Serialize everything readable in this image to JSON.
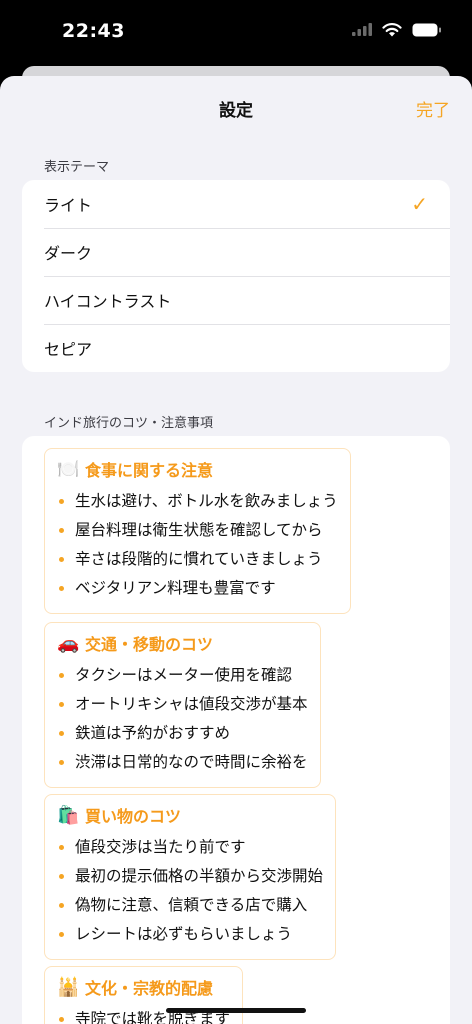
{
  "status": {
    "time": "22:43"
  },
  "nav": {
    "title": "設定",
    "done_label": "完了"
  },
  "theme_section": {
    "header": "表示テーマ",
    "options": [
      {
        "label": "ライト",
        "selected": true
      },
      {
        "label": "ダーク",
        "selected": false
      },
      {
        "label": "ハイコントラスト",
        "selected": false
      },
      {
        "label": "セピア",
        "selected": false
      }
    ],
    "check_glyph": "✓"
  },
  "tips_section": {
    "header": "インド旅行のコツ・注意事項",
    "cards": [
      {
        "emoji": "🍽️",
        "title": "食事に関する注意",
        "items": [
          "生水は避け、ボトル水を飲みましょう",
          "屋台料理は衛生状態を確認してから",
          "辛さは段階的に慣れていきましょう",
          "ベジタリアン料理も豊富です"
        ]
      },
      {
        "emoji": "🚗",
        "title": "交通・移動のコツ",
        "items": [
          "タクシーはメーター使用を確認",
          "オートリキシャは値段交渉が基本",
          "鉄道は予約がおすすめ",
          "渋滞は日常的なので時間に余裕を"
        ]
      },
      {
        "emoji": "🛍️",
        "title": "買い物のコツ",
        "items": [
          "値段交渉は当たり前です",
          "最初の提示価格の半額から交渉開始",
          "偽物に注意、信頼できる店で購入",
          "レシートは必ずもらいましょう"
        ]
      },
      {
        "emoji": "🕌",
        "title": "文化・宗教的配慮",
        "items": [
          "寺院では靴を脱ぎます"
        ]
      }
    ]
  },
  "colors": {
    "accent": "#f5a524",
    "card_border": "#fde3bd"
  }
}
